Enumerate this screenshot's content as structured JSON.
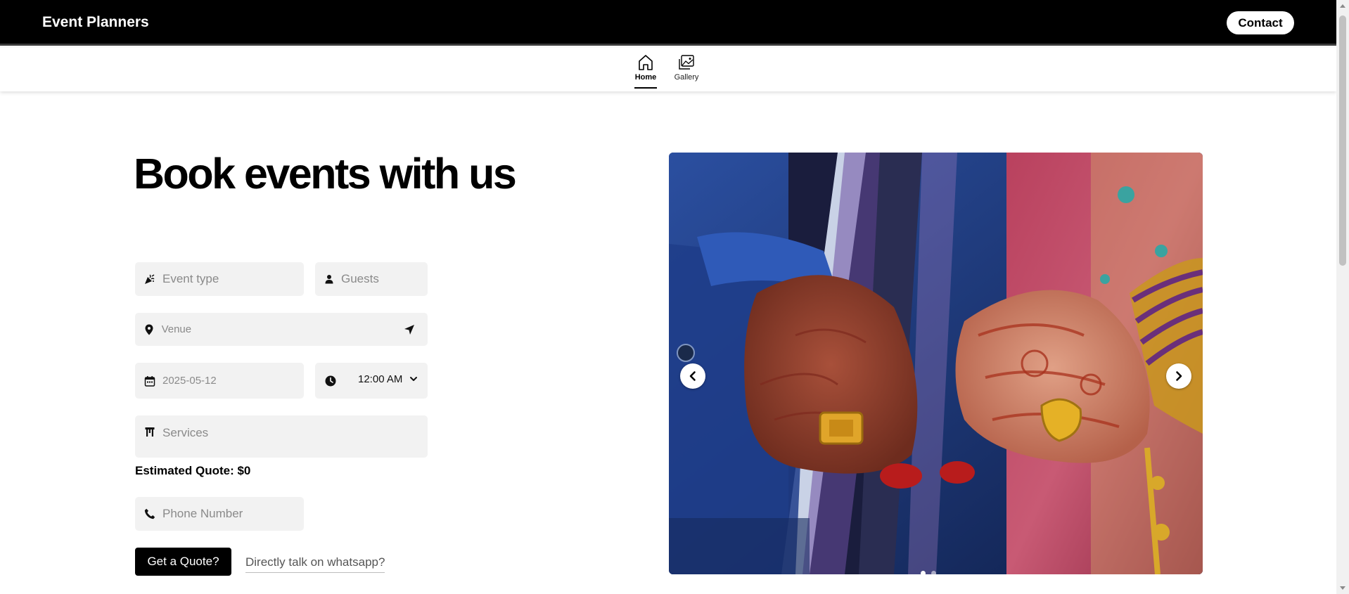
{
  "header": {
    "brand": "Event Planners",
    "contact_label": "Contact"
  },
  "nav": {
    "items": [
      {
        "label": "Home",
        "icon": "home-icon",
        "active": true
      },
      {
        "label": "Gallery",
        "icon": "gallery-icon",
        "active": false
      }
    ]
  },
  "hero": {
    "title": "Book events with us"
  },
  "form": {
    "event_type": {
      "placeholder": "Event type",
      "icon": "party-popper-icon"
    },
    "guests": {
      "placeholder": "Guests",
      "icon": "person-icon"
    },
    "venue": {
      "placeholder": "Venue",
      "icon": "map-pin-icon",
      "action_icon": "locate-arrow-icon"
    },
    "date": {
      "value": "2025-05-12",
      "icon": "calendar-icon"
    },
    "time": {
      "value": "12:00 AM",
      "icon": "clock-icon"
    },
    "services": {
      "placeholder": "Services",
      "icon": "services-icon"
    },
    "estimated_quote": "Estimated Quote: $0",
    "phone": {
      "placeholder": "Phone Number",
      "icon": "phone-icon"
    },
    "submit_label": "Get a Quote?",
    "whatsapp_label": "Directly talk on whatsapp?"
  },
  "carousel": {
    "slide_count": 2,
    "active_slide": 1,
    "image_subject": "hands-with-henna-and-gold-rings"
  },
  "colors": {
    "header_bg": "#000000",
    "field_bg": "#f2f2f2",
    "primary_button": "#000000"
  }
}
